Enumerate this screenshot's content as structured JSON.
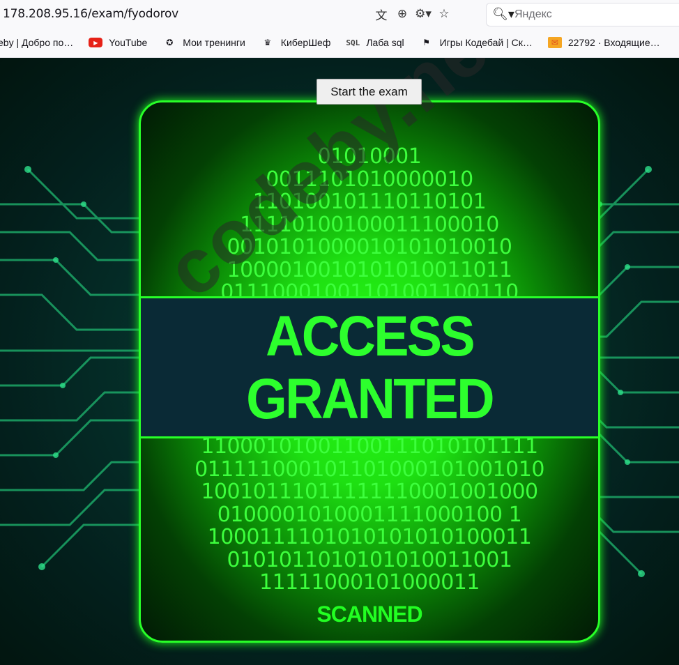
{
  "browser": {
    "url": "178.208.95.16/exam/fyodorov",
    "url_icons": [
      "translate-icon",
      "zoom-icon",
      "tracking-protection-icon",
      "bookmark-star-icon"
    ],
    "search": {
      "placeholder": "Яндекс"
    },
    "bookmarks": [
      {
        "label": "eby | Добро по…",
        "icon": ""
      },
      {
        "label": "YouTube",
        "icon": "youtube-icon"
      },
      {
        "label": "Мои тренинги",
        "icon": "trainings-icon"
      },
      {
        "label": "КиберШеф",
        "icon": "chef-icon"
      },
      {
        "label": "Лаба sql",
        "icon": "sql-icon"
      },
      {
        "label": "Игры Кодебай | Ск…",
        "icon": "flag-icon"
      },
      {
        "label": "22792 · Входящие…",
        "icon": "mail-icon"
      }
    ]
  },
  "page": {
    "start_button": "Start the exam",
    "binary_top": [
      "01010001",
      "0011101010000010",
      "110100101110110101",
      "11110100100011100010",
      "0010101000010101010010",
      "1000010010101010011011",
      "01110001001101001100110"
    ],
    "binary_bottom": [
      "11000101001100111010101111",
      "011111000101101000101001010",
      "10010111011111110001001000",
      "0100001010001111000100 1",
      "1000111101010101010100011",
      "0101011010101010011001",
      "11111000101000011"
    ],
    "access_line1": "ACCESS",
    "access_line2": "GRANTED",
    "scanned": "SCANNED",
    "watermark": "codeby.net"
  },
  "colors": {
    "neon_green": "#28ff28",
    "band": "#0a2a36",
    "bg_dark": "#03201d"
  }
}
